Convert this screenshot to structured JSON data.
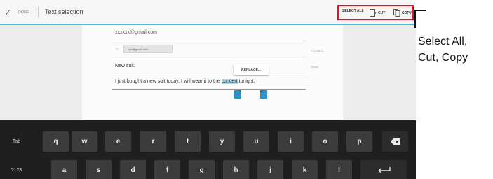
{
  "action_bar": {
    "done_label": "DONE",
    "done_icon": "checkmark-icon",
    "title": "Text selection",
    "select_all_label": "SELECT ALL",
    "cut_label": "CUT",
    "copy_label": "COPY",
    "accent_color": "#4fb3d6",
    "highlight_color": "#e3141b"
  },
  "compose": {
    "from": "xxxxxx@gmail.com",
    "to_label": "To",
    "recipient": "xyz@gmail.com",
    "cc_bcc": "+ CC/BCC",
    "subject": "New suit.",
    "subject_side": "SEND",
    "replace_label": "REPLACE...",
    "body_before": "I just bought a new suit today. I will wear it to the ",
    "body_selected": "concert",
    "body_after": " tonight."
  },
  "keyboard": {
    "row1": [
      "Tab",
      "q",
      "w",
      "e",
      "r",
      "t",
      "y",
      "u",
      "i",
      "o",
      "p"
    ],
    "row2": [
      "?123",
      "a",
      "s",
      "d",
      "f",
      "g",
      "h",
      "j",
      "k",
      "l"
    ],
    "backspace_icon": "backspace-icon",
    "enter_icon": "enter-icon"
  },
  "callout": {
    "line1": "Select All,",
    "line2": "Cut, Copy"
  }
}
